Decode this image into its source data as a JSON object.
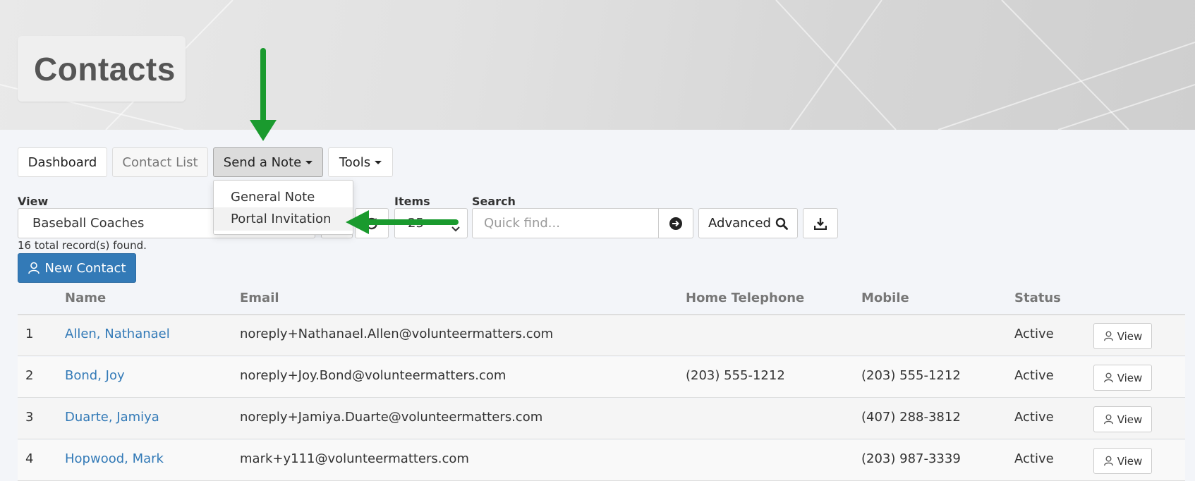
{
  "page": {
    "title": "Contacts"
  },
  "nav": {
    "dashboard": "Dashboard",
    "contact_list": "Contact List",
    "send_note": "Send a Note",
    "tools": "Tools"
  },
  "dropdown": {
    "items": [
      {
        "label": "General Note"
      },
      {
        "label": "Portal Invitation"
      }
    ]
  },
  "filters": {
    "view_label": "View",
    "view_value": "Baseball Coaches",
    "items_label": "Items",
    "items_value": "25",
    "search_label": "Search",
    "search_placeholder": "Quick find...",
    "advanced_label": "Advanced"
  },
  "records_found": "16 total record(s) found.",
  "new_contact_label": "New Contact",
  "table": {
    "headers": {
      "name": "Name",
      "email": "Email",
      "home": "Home Telephone",
      "mobile": "Mobile",
      "status": "Status"
    },
    "view_label": "View",
    "rows": [
      {
        "num": "1",
        "name": "Allen, Nathanael",
        "email": "noreply+Nathanael.Allen@volunteermatters.com",
        "home": "",
        "mobile": "",
        "status": "Active"
      },
      {
        "num": "2",
        "name": "Bond, Joy",
        "email": "noreply+Joy.Bond@volunteermatters.com",
        "home": "(203) 555-1212",
        "mobile": "(203) 555-1212",
        "status": "Active"
      },
      {
        "num": "3",
        "name": "Duarte, Jamiya",
        "email": "noreply+Jamiya.Duarte@volunteermatters.com",
        "home": "",
        "mobile": "(407) 288-3812",
        "status": "Active"
      },
      {
        "num": "4",
        "name": "Hopwood, Mark",
        "email": "mark+y111@volunteermatters.com",
        "home": "",
        "mobile": "(203) 987-3339",
        "status": "Active"
      }
    ]
  },
  "colors": {
    "primary": "#337ab7",
    "annotation_arrow": "#1a9a2e"
  },
  "icons": {
    "refresh": "refresh-icon",
    "search_go": "circle-arrow-right-icon",
    "advanced": "search-icon",
    "download": "download-icon",
    "new_contact": "user-icon",
    "view": "user-icon"
  }
}
